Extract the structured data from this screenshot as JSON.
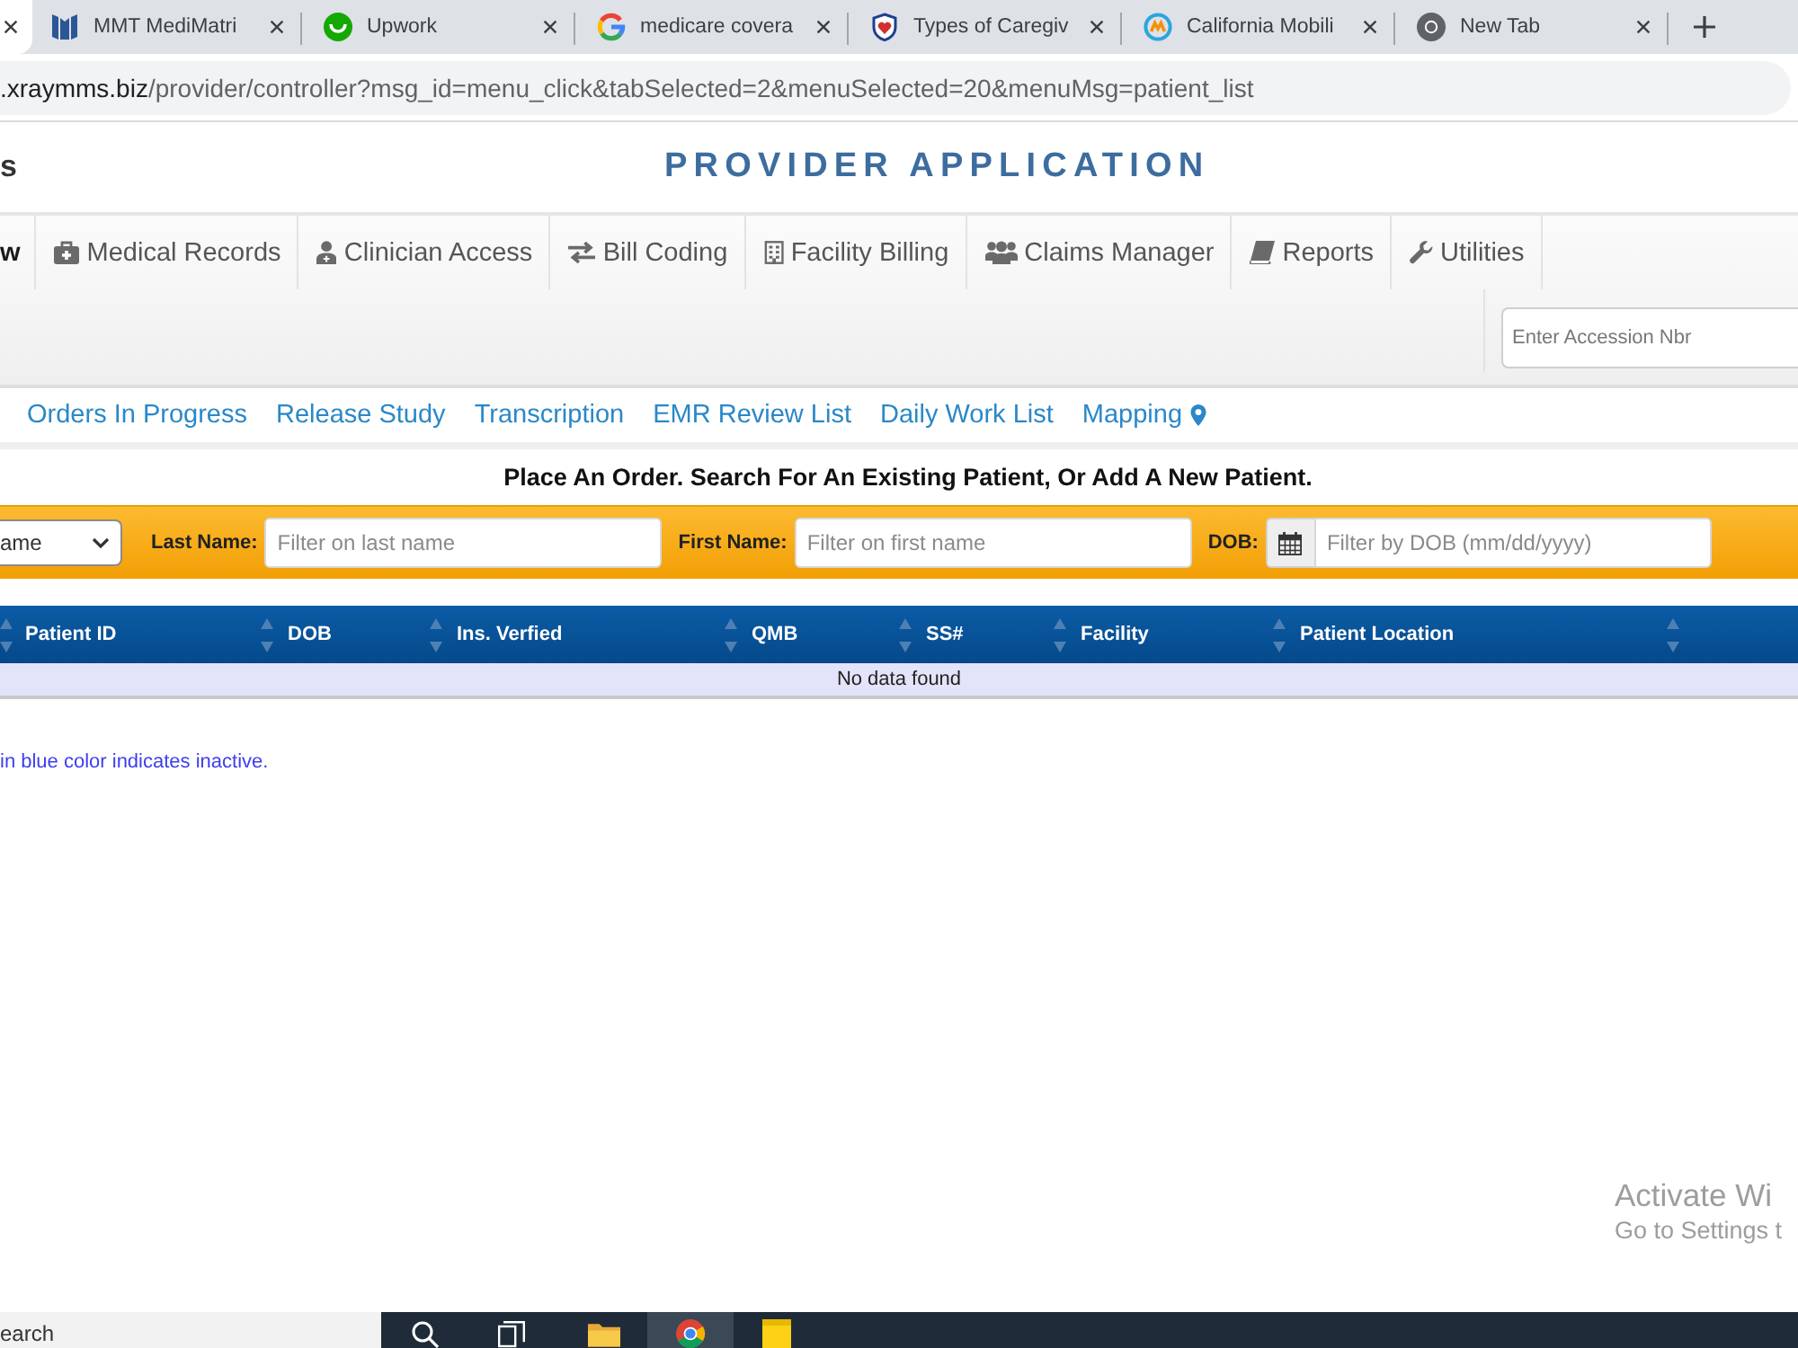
{
  "browser": {
    "tabs": [
      {
        "selected": true
      },
      {
        "title": "MMT MediMatri",
        "selected": false
      },
      {
        "title": "Upwork",
        "selected": false
      },
      {
        "title": "medicare covera",
        "selected": false
      },
      {
        "title": "Types of Caregiv",
        "selected": false
      },
      {
        "title": "California Mobili",
        "selected": false
      },
      {
        "title": "New Tab",
        "selected": false
      }
    ],
    "address": {
      "host": ".xraymms.biz",
      "path": "/provider/controller?msg_id=menu_click&tabSelected=2&menuSelected=20&menuMsg=patient_list"
    }
  },
  "header": {
    "brand": "s",
    "title": "PROVIDER APPLICATION"
  },
  "main_menu": [
    {
      "label": "w",
      "selected": true
    },
    {
      "label": "Medical Records",
      "selected": false
    },
    {
      "label": "Clinician Access",
      "selected": false
    },
    {
      "label": "Bill Coding",
      "selected": false
    },
    {
      "label": "Facility Billing",
      "selected": false
    },
    {
      "label": "Claims Manager",
      "selected": false
    },
    {
      "label": "Reports",
      "selected": false
    },
    {
      "label": "Utilities",
      "selected": false
    }
  ],
  "accession_search": {
    "placeholder": "Enter Accession Nbr"
  },
  "sub_menu": [
    "Orders In Progress",
    "Release Study",
    "Transcription",
    "EMR Review List",
    "Daily Work List",
    "Mapping"
  ],
  "heading": "Place An Order. Search For An Existing Patient, Or Add A New Patient.",
  "filters": {
    "search_by": {
      "value": "ame"
    },
    "fields": [
      {
        "kind": "text",
        "label": "Last Name:",
        "placeholder": "Filter on last name"
      },
      {
        "kind": "text",
        "label": "First Name:",
        "placeholder": "Filter on first name"
      },
      {
        "kind": "date",
        "label": "DOB:",
        "placeholder": "Filter by DOB (mm/dd/yyyy)"
      }
    ]
  },
  "table": {
    "columns": [
      "Patient ID",
      "DOB",
      "Ins. Verfied",
      "QMB",
      "SS#",
      "Facility",
      "Patient Location"
    ],
    "empty_message": "No data found"
  },
  "note": "in blue color indicates inactive.",
  "activation_notice": {
    "title": "Activate Wi",
    "subtitle": "Go to Settings t"
  },
  "taskbar": {
    "search_placeholder": "earch",
    "apps": [
      {
        "selected": false
      },
      {
        "selected": true
      },
      {
        "selected": false
      }
    ]
  }
}
